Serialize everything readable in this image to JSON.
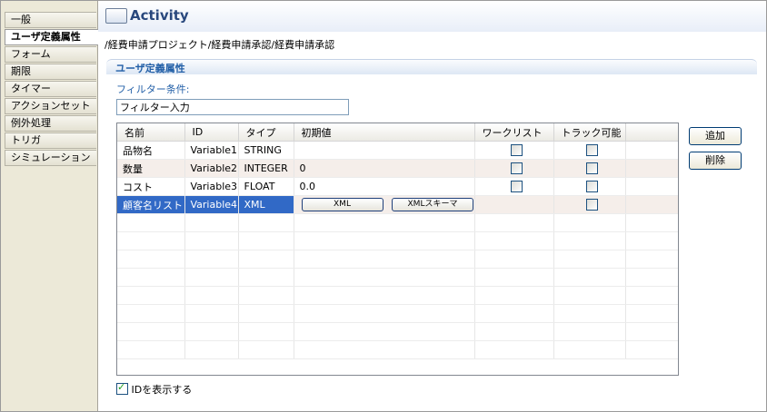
{
  "sidebar": {
    "tabs": [
      {
        "label": "一般",
        "active": false
      },
      {
        "label": "ユーザ定義属性",
        "active": true
      },
      {
        "label": "フォーム",
        "active": false
      },
      {
        "label": "期限",
        "active": false
      },
      {
        "label": "タイマー",
        "active": false
      },
      {
        "label": "アクションセット",
        "active": false
      },
      {
        "label": "例外処理",
        "active": false
      },
      {
        "label": "トリガ",
        "active": false
      },
      {
        "label": "シミュレーション",
        "active": false
      }
    ]
  },
  "header": {
    "icon": "activity-icon",
    "title": "Activity"
  },
  "breadcrumb": "/経費申請プロジェクト/経費申請承認/経費申請承認",
  "section": {
    "title": "ユーザ定義属性",
    "filter_label": "フィルター条件:",
    "filter_value": "フィルター入力"
  },
  "table": {
    "columns": [
      "名前",
      "ID",
      "タイプ",
      "初期値",
      "ワークリスト",
      "トラック可能"
    ],
    "rows": [
      {
        "name": "品物名",
        "id": "Variable1",
        "type": "STRING",
        "initial": "",
        "worklist": false,
        "trackable": false
      },
      {
        "name": "数量",
        "id": "Variable2",
        "type": "INTEGER",
        "initial": "0",
        "worklist": false,
        "trackable": false
      },
      {
        "name": "コスト",
        "id": "Variable3",
        "type": "FLOAT",
        "initial": "0.0",
        "worklist": false,
        "trackable": false
      },
      {
        "name": "顧客名リスト",
        "id": "Variable4",
        "type": "XML",
        "initial": "",
        "worklist": null,
        "trackable": false,
        "selected": true,
        "buttons": [
          "XML",
          "XMLスキーマ"
        ]
      }
    ]
  },
  "buttons": {
    "add": "追加",
    "delete": "削除"
  },
  "show_id": {
    "label": "IDを表示する",
    "checked": true
  }
}
